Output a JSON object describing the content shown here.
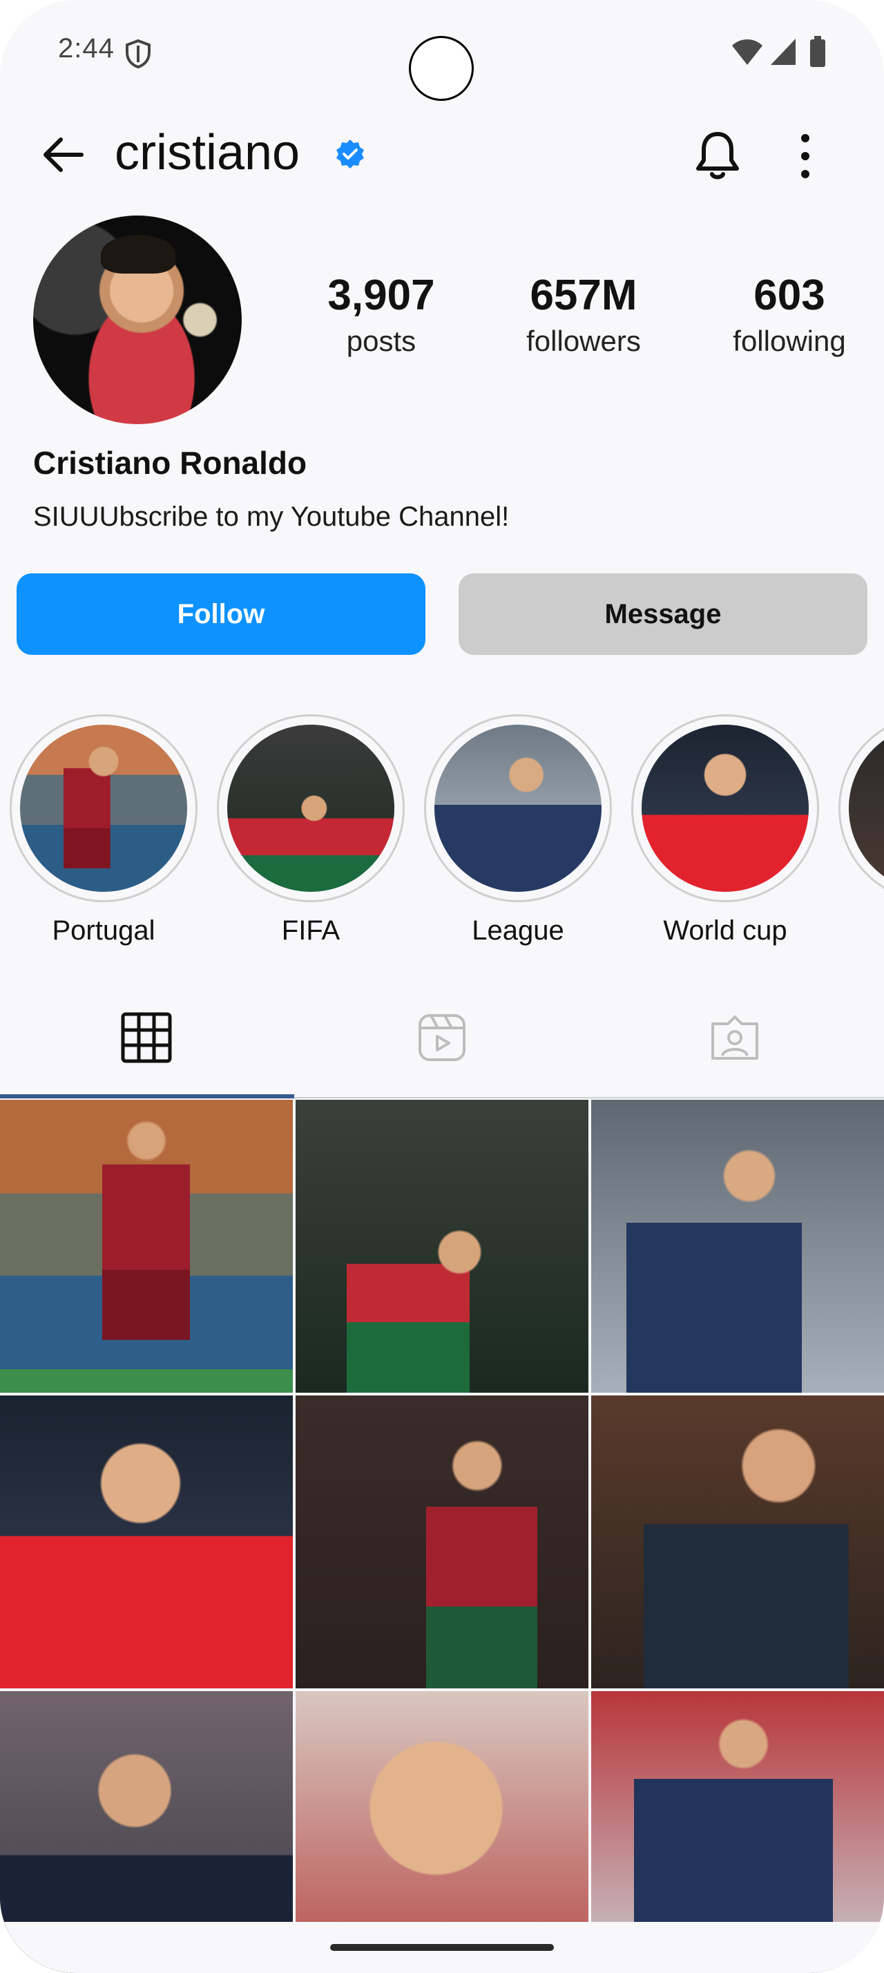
{
  "status_bar": {
    "time": "2:44"
  },
  "header": {
    "username": "cristiano"
  },
  "profile": {
    "stats": [
      {
        "value": "3,907",
        "label": "posts"
      },
      {
        "value": "657M",
        "label": "followers"
      },
      {
        "value": "603",
        "label": "following"
      }
    ],
    "full_name": "Cristiano Ronaldo",
    "bio": "SIUUUbscribe to my Youtube Channel!"
  },
  "actions": {
    "follow_label": "Follow",
    "message_label": "Message"
  },
  "highlights": [
    {
      "label": "Portugal"
    },
    {
      "label": "FIFA"
    },
    {
      "label": "League"
    },
    {
      "label": "World cup"
    },
    {
      "label": ""
    }
  ],
  "tabs": {
    "active": "grid",
    "icons": [
      "grid-icon",
      "reels-icon",
      "tagged-icon"
    ]
  },
  "colors": {
    "accent": "#0d92ff",
    "verified": "#1a8cff",
    "message_button": "#cccccc"
  }
}
